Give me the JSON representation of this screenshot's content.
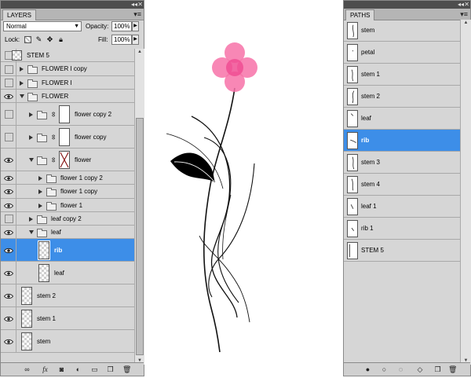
{
  "layers_panel": {
    "tab": "LAYERS",
    "blend_mode": "Normal",
    "opacity_label": "Opacity:",
    "opacity_value": "100%",
    "lock_label": "Lock:",
    "fill_label": "Fill:",
    "fill_value": "100%",
    "rows": [
      {
        "name": "STEM 5",
        "kind": "layer",
        "visible": false,
        "indent": 0
      },
      {
        "name": "FLOWER I copy",
        "kind": "group",
        "visible": false,
        "expanded": false,
        "indent": 0
      },
      {
        "name": "FLOWER I",
        "kind": "group",
        "visible": false,
        "expanded": false,
        "indent": 0
      },
      {
        "name": "FLOWER",
        "kind": "group",
        "visible": true,
        "expanded": true,
        "indent": 0
      },
      {
        "name": "flower copy 2",
        "kind": "masked-group",
        "visible": false,
        "expanded": false,
        "indent": 1
      },
      {
        "name": "flower copy",
        "kind": "masked-group",
        "visible": false,
        "expanded": false,
        "indent": 1
      },
      {
        "name": "flower",
        "kind": "masked-group",
        "visible": true,
        "expanded": true,
        "indent": 1
      },
      {
        "name": "flower 1 copy 2",
        "kind": "group",
        "visible": true,
        "expanded": false,
        "indent": 2
      },
      {
        "name": "flower 1 copy",
        "kind": "group",
        "visible": true,
        "expanded": false,
        "indent": 2
      },
      {
        "name": "flower 1",
        "kind": "group",
        "visible": true,
        "expanded": false,
        "indent": 2
      },
      {
        "name": "leaf copy 2",
        "kind": "group",
        "visible": false,
        "expanded": false,
        "indent": 1
      },
      {
        "name": "leaf",
        "kind": "group",
        "visible": true,
        "expanded": true,
        "indent": 1
      },
      {
        "name": "rib",
        "kind": "layer",
        "visible": true,
        "indent": 2,
        "selected": true
      },
      {
        "name": "leaf",
        "kind": "layer",
        "visible": true,
        "indent": 2
      },
      {
        "name": "stem 2",
        "kind": "layer",
        "visible": true,
        "indent": 1
      },
      {
        "name": "stem 1",
        "kind": "layer",
        "visible": true,
        "indent": 1
      },
      {
        "name": "stem",
        "kind": "layer",
        "visible": true,
        "indent": 1
      }
    ],
    "footer_icons": [
      "link-layers-icon",
      "fx-icon",
      "add-mask-icon",
      "adjustment-layer-icon",
      "new-group-icon",
      "new-layer-icon",
      "delete-layer-icon"
    ]
  },
  "paths_panel": {
    "tab": "PATHS",
    "rows": [
      {
        "name": "stem"
      },
      {
        "name": "petal"
      },
      {
        "name": "stem 1"
      },
      {
        "name": "stem 2"
      },
      {
        "name": "leaf"
      },
      {
        "name": "rib",
        "selected": true
      },
      {
        "name": "stem 3"
      },
      {
        "name": "stem 4"
      },
      {
        "name": "leaf 1"
      },
      {
        "name": "rib 1"
      },
      {
        "name": "STEM 5"
      }
    ],
    "footer_icons": [
      "fill-path-icon",
      "stroke-path-icon",
      "load-selection-icon",
      "make-work-path-icon",
      "new-path-icon",
      "delete-path-icon"
    ]
  },
  "colors": {
    "selection": "#3d8ee8",
    "petal": "#f772a8",
    "panel_bg": "#d6d6d6",
    "titlebar": "#4d4d4d"
  }
}
